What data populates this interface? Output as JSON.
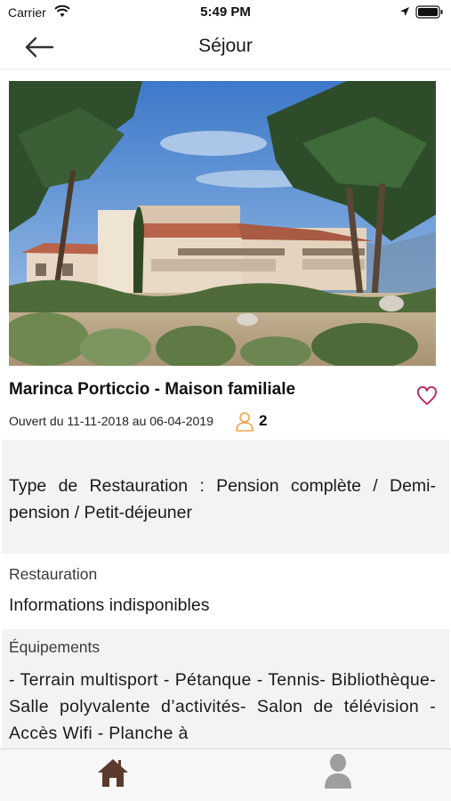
{
  "status_bar": {
    "carrier": "Carrier",
    "time": "5:49 PM"
  },
  "nav": {
    "title": "Séjour",
    "back_icon": "arrow-left-icon"
  },
  "listing": {
    "name": "Marinca Porticcio - Maison familiale",
    "dates": "Ouvert du 11-11-2018 au 06-04-2019",
    "capacity": "2",
    "favorite_icon": "heart-outline-icon",
    "favorite_color": "#c2185b",
    "accent_color": "#f0a24a"
  },
  "sections": {
    "type_restauration": "Type de Restauration : Pension complète / Demi-pension / Petit-déjeuner",
    "restauration_label": "Restauration",
    "restauration_value": "Informations indisponibles",
    "equipements_label": "Équipements",
    "equipements_value": "- Terrain multisport - Pétanque - Tennis- Bibliothèque- Salle polyvalente d’activités- Salon de télévision - Accès Wifi - Planche à"
  },
  "tab_bar": {
    "home_icon": "home-icon",
    "home_color": "#5b3a2e",
    "profile_icon": "user-icon",
    "profile_color": "#9e9e9e"
  }
}
